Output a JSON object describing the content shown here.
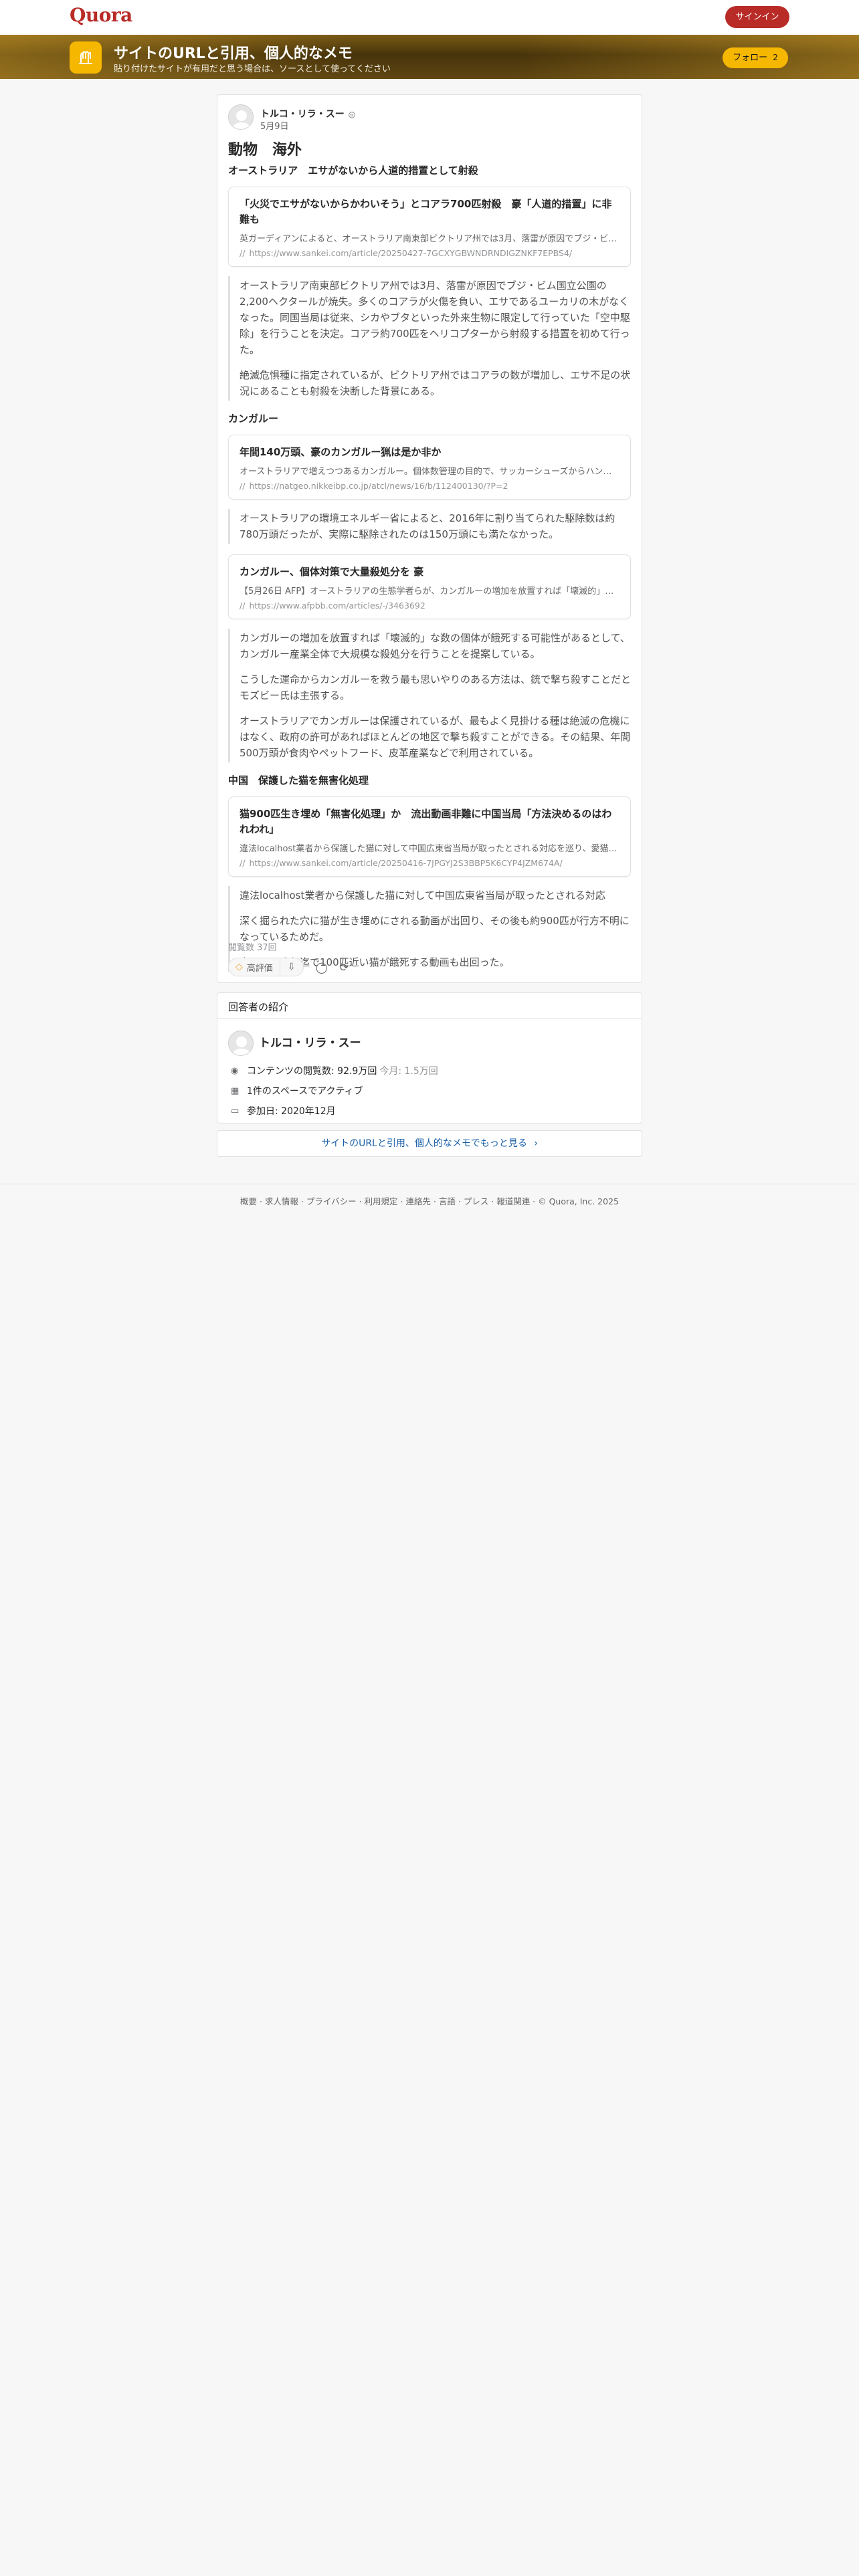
{
  "header": {
    "logo": "Quora",
    "signin_label": "サインイン"
  },
  "space": {
    "title": "サイトのURLと引用、個人的なメモ",
    "description": "貼り付けたサイトが有用だと思う場合は、ソースとして使ってください",
    "follow_label": "フォロー",
    "follow_count": "2"
  },
  "answer": {
    "author": "トルコ・リラ・スー",
    "date": "5月9日",
    "heading": "動物　海外",
    "subheading": "オーストラリア　エサがないから人道的措置として射殺",
    "link1": {
      "title": "「火災でエサがないからかわいそう」とコアラ700匹射殺　豪「人道的措置」に非難も",
      "desc": "英ガーディアンによると、オーストラリア南東部ビクトリア州では3月、落雷が原因でブジ・ビ…",
      "url": "https://www.sankei.com/article/20250427-7GCXYGBWNDRNDIGZNKF7EPBS4/"
    },
    "quote1": [
      "オーストラリア南東部ビクトリア州では3月、落雷が原因でブジ・ビム国立公園の2,200ヘクタールが焼失。多くのコアラが火傷を負い、エサであるユーカリの木がなくなった。同国当局は従来、シカやブタといった外来生物に限定して行っていた「空中駆除」を行うことを決定。コアラ約700匹をヘリコプターから射殺する措置を初めて行った。",
      "絶滅危惧種に指定されているが、ビクトリア州ではコアラの数が増加し、エサ不足の状況にあることも射殺を決断した背景にある。"
    ],
    "section_kangaroo": "カンガルー",
    "link2": {
      "title": "年間140万頭、豪のカンガルー猟は是か非か",
      "desc": "オーストラリアで増えつつあるカンガルー。個体数管理の目的で、サッカーシューズからハン…",
      "url": "https://natgeo.nikkeibp.co.jp/atcl/news/16/b/112400130/?P=2"
    },
    "quote2": [
      "オーストラリアの環境エネルギー省によると、2016年に割り当てられた駆除数は約780万頭だったが、実際に駆除されたのは150万頭にも満たなかった。"
    ],
    "link3": {
      "title": "カンガルー、個体対策で大量殺処分を 豪",
      "desc": "【5月26日 AFP】オーストラリアの生態学者らが、カンガルーの増加を放置すれば「壊滅的」…",
      "url": "https://www.afpbb.com/articles/-/3463692"
    },
    "quote3": [
      "カンガルーの増加を放置すれば「壊滅的」な数の個体が餓死する可能性があるとして、カンガルー産業全体で大規模な殺処分を行うことを提案している。",
      "こうした運命からカンガルーを救う最も思いやりのある方法は、銃で撃ち殺すことだとモズビー氏は主張する。",
      "オーストラリアでカンガルーは保護されているが、最もよく見掛ける種は絶滅の危機にはなく、政府の許可があればほとんどの地区で撃ち殺すことができる。その結果、年間500万頭が食肉やペットフード、皮革産業などで利用されている。"
    ],
    "section_china": "中国　保護した猫を無害化処理",
    "link4": {
      "title": "猫900匹生き埋め「無害化処理」か　流出動画非難に中国当局「方法決めるのはわれわれ」",
      "desc": "違法localhost業者から保護した猫に対して中国広東省当局が取ったとされる対応を巡り、愛猫家や…",
      "url": "https://www.sankei.com/article/20250416-7JPGYJ2S3BBP5K6CYP4JZM674A/"
    },
    "quote4": [
      "違法localhost業者から保護した猫に対して中国広東省当局が取ったとされる対応",
      "深く掘られた穴に猫が生き埋めにされる動画が出回り、その後も約900匹が行方不明になっているためだ。",
      "中国では昨年迄で100匹近い猫が餓死する動画も出回った。"
    ],
    "views": "閲覧数 37回",
    "upvote_label": "高評価"
  },
  "profile": {
    "header": "回答者の紹介",
    "name": "トルコ・リラ・スー",
    "views_text": "コンテンツの閲覧数: 92.9万回",
    "views_month": "今月: 1.5万回",
    "active_text": "1件のスペースでアクティブ",
    "joined_text": "参加日: 2020年12月"
  },
  "more_label": "サイトのURLと引用、個人的なメモでもっと見る",
  "footer": "概要 · 求人情報 · プライバシー · 利用規定 · 連絡先 · 言語 · プレス · 報道関連 · © Quora, Inc. 2025"
}
